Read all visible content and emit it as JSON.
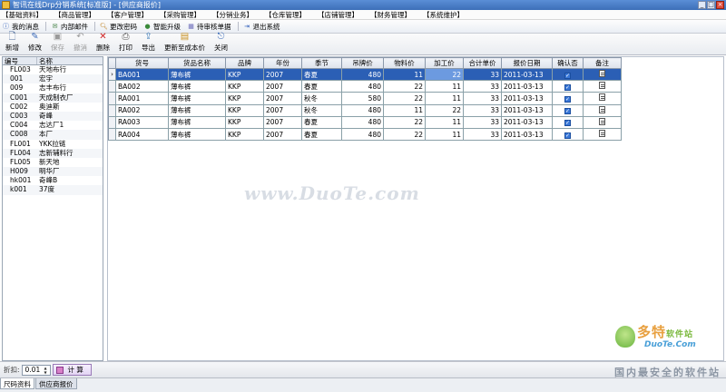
{
  "window": {
    "title": "智讯在线Drp分销系统[标准版] - [供应商报价]",
    "controls": {
      "minimize": "_",
      "restore": "□",
      "close": "×"
    }
  },
  "menu": [
    "【基础资料】",
    "【商品管理】",
    "【客户管理】",
    "【采购管理】",
    "【分销业务】",
    "【仓库管理】",
    "【店铺管理】",
    "【财务管理】",
    "【系统维护】"
  ],
  "quickbar": [
    {
      "label": "我的消息",
      "icon": "info-icon"
    },
    {
      "label": "内部邮件",
      "icon": "mail-icon"
    },
    {
      "label": "更改密码",
      "icon": "key-icon"
    },
    {
      "label": "智能升级",
      "icon": "upgrade-icon"
    },
    {
      "label": "待审核单据",
      "icon": "pending-icon"
    },
    {
      "label": "退出系统",
      "icon": "exit-icon"
    }
  ],
  "toolbar": {
    "new": "新增",
    "edit": "修改",
    "save": "保存",
    "undo": "撤消",
    "delete": "删除",
    "print": "打印",
    "export": "导出",
    "update_cost": "更新至成本价",
    "close": "关闭"
  },
  "left_panel": {
    "columns": [
      "编号",
      "名称"
    ],
    "rows": [
      {
        "code": "FL003",
        "name": "天地布行"
      },
      {
        "code": "001",
        "name": "宏宇"
      },
      {
        "code": "009",
        "name": "志丰布行"
      },
      {
        "code": "C001",
        "name": "天成制衣厂"
      },
      {
        "code": "C002",
        "name": "奥迪斯"
      },
      {
        "code": "C003",
        "name": "奇峰"
      },
      {
        "code": "C004",
        "name": "志达厂1"
      },
      {
        "code": "C008",
        "name": "本厂"
      },
      {
        "code": "FL001",
        "name": "YKK拉链"
      },
      {
        "code": "FL004",
        "name": "志新辅料行"
      },
      {
        "code": "FL005",
        "name": "新天地"
      },
      {
        "code": "H009",
        "name": "明华厂"
      },
      {
        "code": "hk001",
        "name": "奇峰B"
      },
      {
        "code": "k001",
        "name": "37度"
      }
    ]
  },
  "grid": {
    "columns": [
      "货号",
      "货品名称",
      "品牌",
      "年份",
      "季节",
      "吊牌价",
      "物料价",
      "加工价",
      "合计单价",
      "报价日期",
      "确认否",
      "备注"
    ],
    "rows": [
      {
        "sku": "BA001",
        "name": "薄布裤",
        "brand": "KKP",
        "year": "2007",
        "season": "春夏",
        "tag_price": "480",
        "material": "11",
        "process": "22",
        "total": "33",
        "date": "2011-03-13",
        "confirmed": "✓"
      },
      {
        "sku": "BA002",
        "name": "薄布裤",
        "brand": "KKP",
        "year": "2007",
        "season": "春夏",
        "tag_price": "480",
        "material": "22",
        "process": "11",
        "total": "33",
        "date": "2011-03-13",
        "confirmed": "✓"
      },
      {
        "sku": "RA001",
        "name": "薄布裤",
        "brand": "KKP",
        "year": "2007",
        "season": "秋冬",
        "tag_price": "580",
        "material": "22",
        "process": "11",
        "total": "33",
        "date": "2011-03-13",
        "confirmed": "✓"
      },
      {
        "sku": "RA002",
        "name": "薄布裤",
        "brand": "KKP",
        "year": "2007",
        "season": "秋冬",
        "tag_price": "480",
        "material": "11",
        "process": "22",
        "total": "33",
        "date": "2011-03-13",
        "confirmed": "✓"
      },
      {
        "sku": "RA003",
        "name": "薄布裤",
        "brand": "KKP",
        "year": "2007",
        "season": "春夏",
        "tag_price": "480",
        "material": "22",
        "process": "11",
        "total": "33",
        "date": "2011-03-13",
        "confirmed": "✓"
      },
      {
        "sku": "RA004",
        "name": "薄布裤",
        "brand": "KKP",
        "year": "2007",
        "season": "春夏",
        "tag_price": "480",
        "material": "22",
        "process": "11",
        "total": "33",
        "date": "2011-03-13",
        "confirmed": "✓"
      }
    ]
  },
  "footer": {
    "discount_label": "折扣:",
    "discount_value": "0.01",
    "calc_button": "计 算"
  },
  "tabs": [
    "尺码资料",
    "供应商报价"
  ],
  "watermark": "www.DuoTe.com",
  "logo": {
    "main": "多特",
    "sub": "软件站",
    "domain": "DuoTe.Com"
  },
  "slogan": "国内最安全的软件站",
  "colors": {
    "selection": "#2b5fb5",
    "titlebar": "#3d6fb8",
    "watermark": "#d8dde4"
  }
}
